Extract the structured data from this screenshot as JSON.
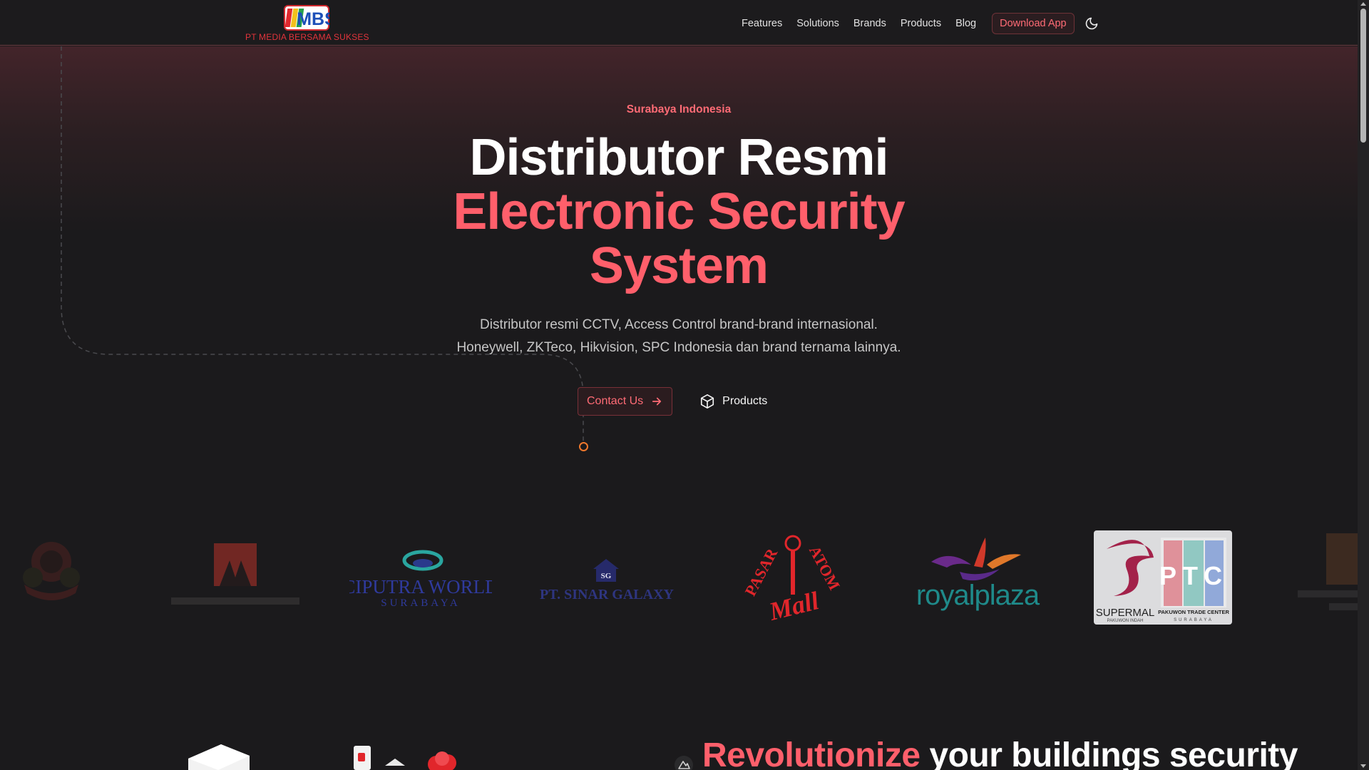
{
  "header": {
    "logo_text": "MBS",
    "logo_subtext": "PT MEDIA BERSAMA SUKSES",
    "nav": [
      "Features",
      "Solutions",
      "Brands",
      "Products",
      "Blog"
    ],
    "download_label": "Download App",
    "theme_icon": "moon-icon"
  },
  "hero": {
    "eyebrow": "Surabaya Indonesia",
    "title_line1": "Distributor Resmi",
    "title_line2": "Electronic Security",
    "title_line3": "System",
    "subtitle_line1": "Distributor resmi CCTV, Access Control brand-brand internasional.",
    "subtitle_line2": "Honeywell, ZKTeco, Hikvision, SPC Indonesia dan brand ternama lainnya.",
    "contact_label": "Contact Us",
    "products_label": "Products"
  },
  "clients": {
    "ciputra_line1": "CIPUTRA WORLD",
    "ciputra_line2": "SURABAYA",
    "sinar_mark": "SG",
    "sinar_name": "PT. SINAR GALAXY",
    "pasar_atom_word1": "PASAR",
    "pasar_atom_word2": "ATOM",
    "pasar_atom_word3": "Mall",
    "royal_plaza": "royalplaza",
    "ptc_letters": "PTC",
    "ptc_caption": "PAKUWON TRADE CENTER",
    "ptc_left": "SUPERMAL",
    "ptc_left_sub": "PAKUWON INDAH",
    "ptc_right_sub": "SURABAYA"
  },
  "section": {
    "title_accent": "Revolutionize",
    "title_rest": " your buildings security"
  },
  "colors": {
    "accent": "#ff5f6b",
    "background": "#1b1a1c",
    "header_border": "#6b3a40"
  }
}
